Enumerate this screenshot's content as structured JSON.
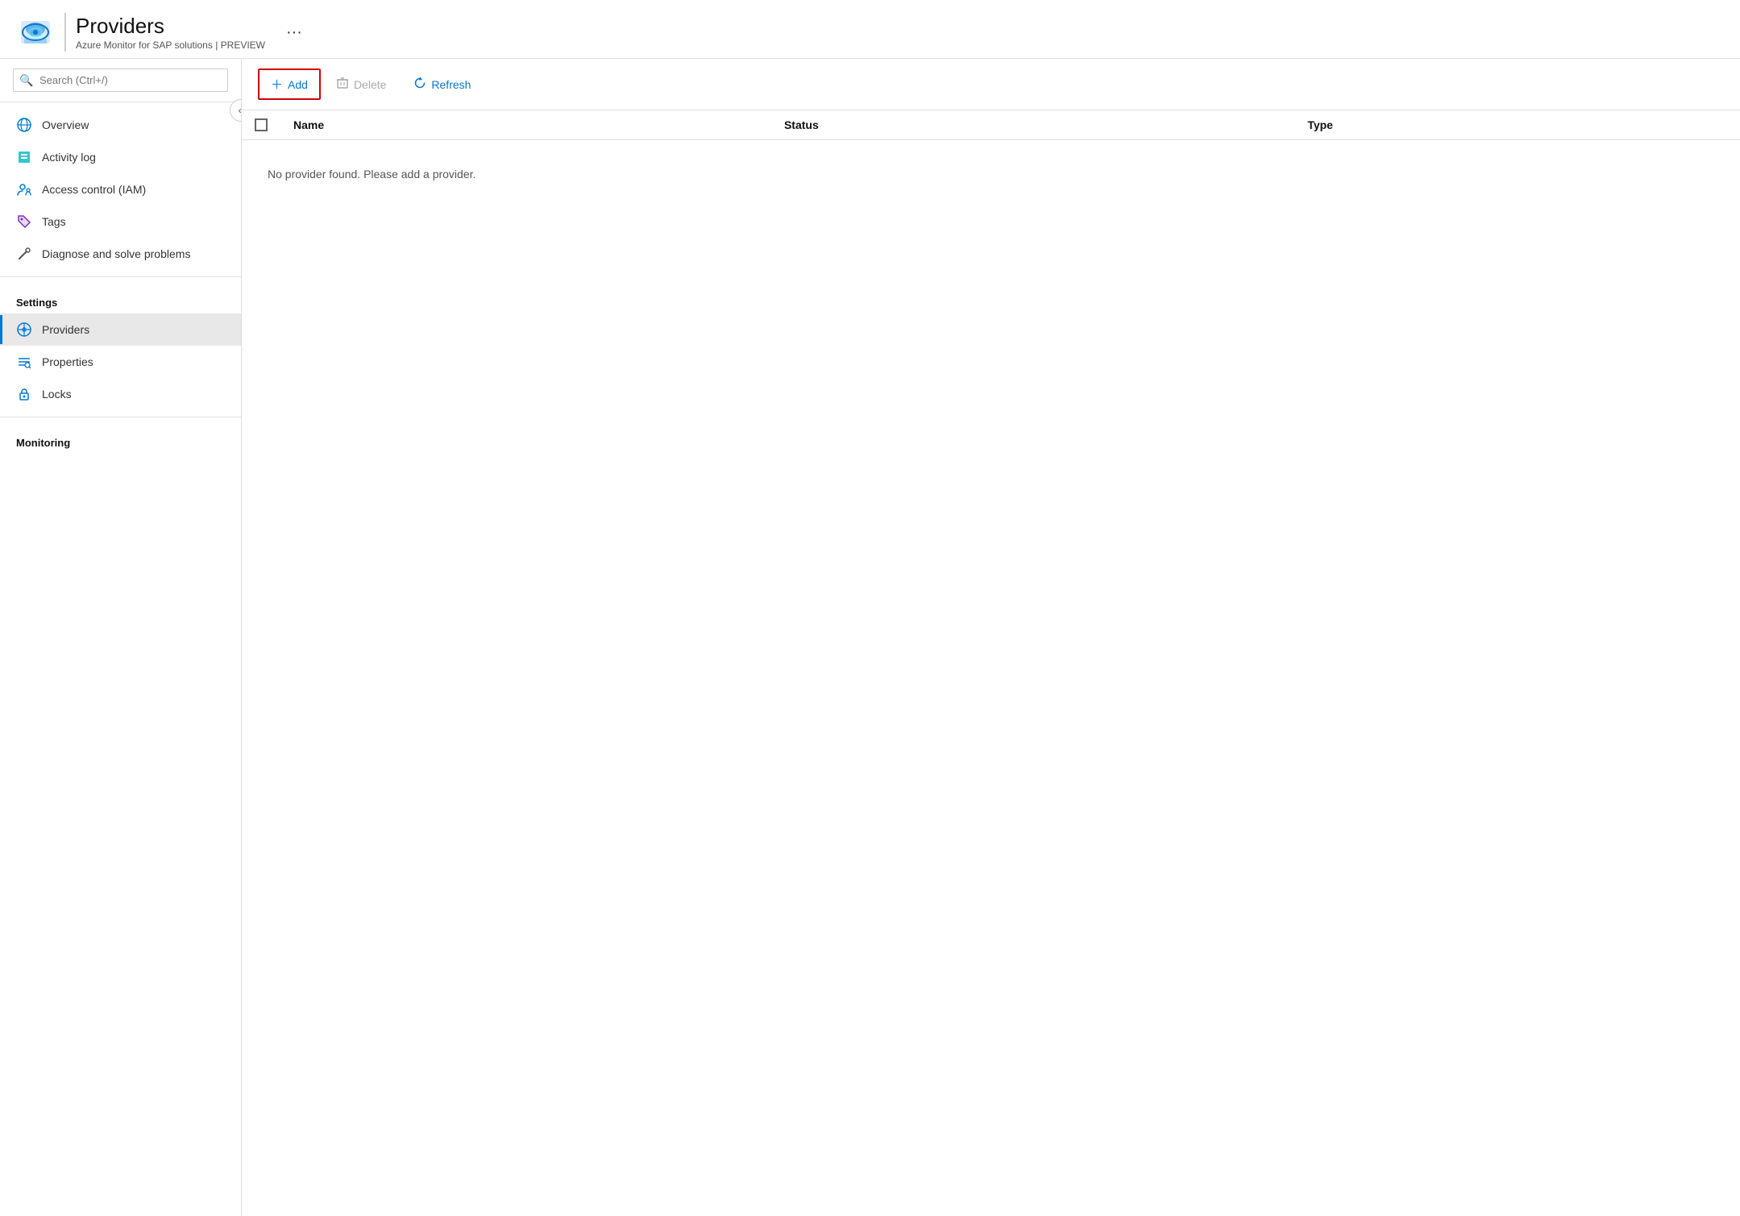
{
  "header": {
    "title": "Providers",
    "subtitle": "Azure Monitor for SAP solutions | PREVIEW",
    "more_label": "···"
  },
  "search": {
    "placeholder": "Search (Ctrl+/)"
  },
  "sidebar": {
    "collapse_icon": "«",
    "nav_items": [
      {
        "id": "overview",
        "label": "Overview",
        "icon": "🌐",
        "icon_color": "icon-blue",
        "active": false
      },
      {
        "id": "activity-log",
        "label": "Activity log",
        "icon": "📋",
        "icon_color": "icon-teal",
        "active": false
      },
      {
        "id": "access-control",
        "label": "Access control (IAM)",
        "icon": "👥",
        "icon_color": "icon-blue",
        "active": false
      },
      {
        "id": "tags",
        "label": "Tags",
        "icon": "🏷",
        "icon_color": "icon-purple",
        "active": false
      },
      {
        "id": "diagnose",
        "label": "Diagnose and solve problems",
        "icon": "🔧",
        "icon_color": "icon-gray",
        "active": false
      }
    ],
    "sections": [
      {
        "label": "Settings",
        "items": [
          {
            "id": "providers",
            "label": "Providers",
            "icon": "⚙",
            "icon_color": "icon-blue",
            "active": true
          },
          {
            "id": "properties",
            "label": "Properties",
            "icon": "≡",
            "icon_color": "icon-blue",
            "active": false
          },
          {
            "id": "locks",
            "label": "Locks",
            "icon": "🔒",
            "icon_color": "icon-blue",
            "active": false
          }
        ]
      },
      {
        "label": "Monitoring",
        "items": []
      }
    ]
  },
  "toolbar": {
    "add_label": "Add",
    "delete_label": "Delete",
    "refresh_label": "Refresh"
  },
  "table": {
    "columns": [
      "Name",
      "Status",
      "Type"
    ],
    "empty_message": "No provider found. Please add a provider."
  }
}
